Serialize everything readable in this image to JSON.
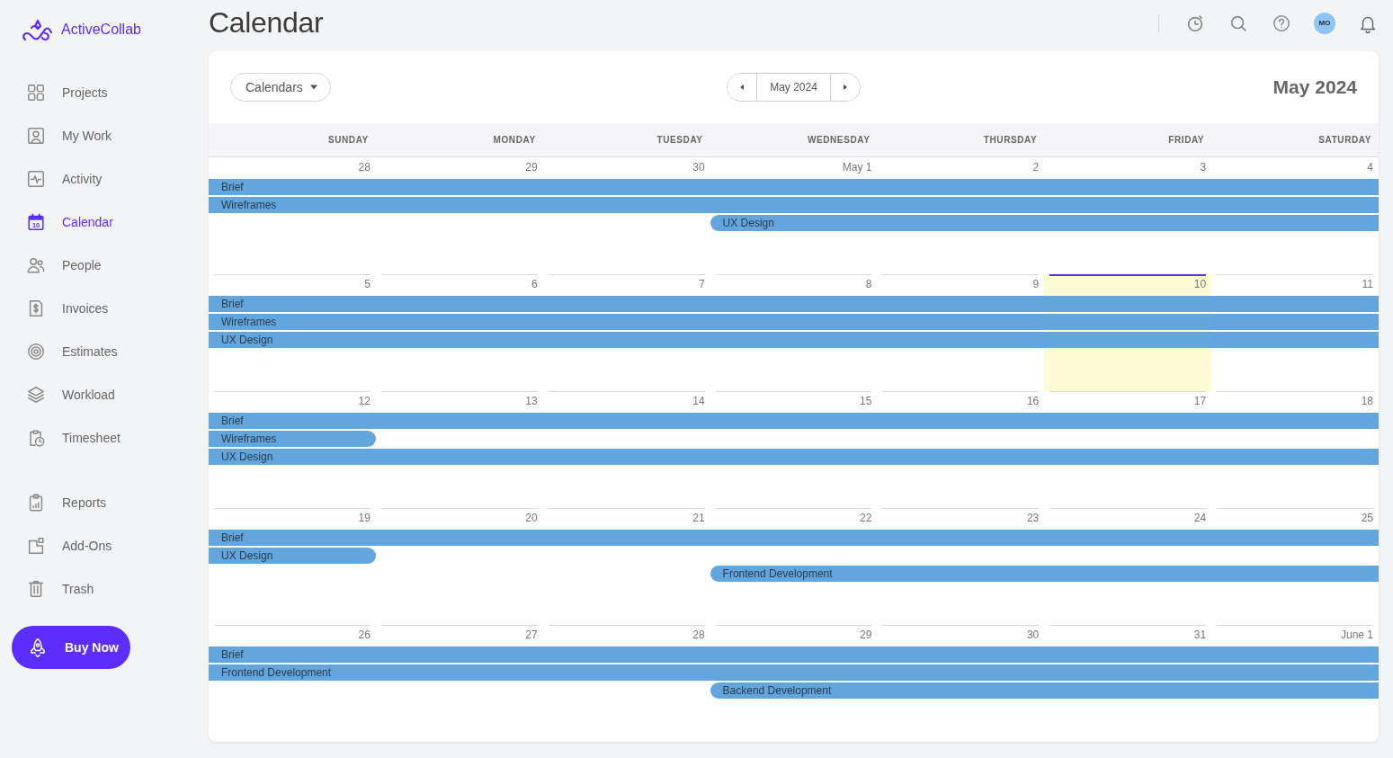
{
  "sidebar": {
    "logo": "ActiveCollab",
    "nav_groups": [
      [
        {
          "label": "Projects",
          "kind": "grid",
          "selected": false
        },
        {
          "label": "My Work",
          "kind": "user",
          "selected": false
        },
        {
          "label": "Activity",
          "kind": "activity",
          "selected": false
        },
        {
          "label": "Calendar",
          "kind": "calendar",
          "icon_text": "10",
          "selected": true
        },
        {
          "label": "People",
          "kind": "people",
          "selected": false
        },
        {
          "label": "Invoices",
          "kind": "invoice",
          "selected": false
        },
        {
          "label": "Estimates",
          "kind": "target",
          "selected": false
        },
        {
          "label": "Workload",
          "kind": "layers",
          "selected": false
        },
        {
          "label": "Timesheet",
          "kind": "timesheet",
          "selected": false
        }
      ],
      [
        {
          "label": "Reports",
          "kind": "reports",
          "selected": false
        },
        {
          "label": "Add-Ons",
          "kind": "addons",
          "selected": false
        },
        {
          "label": "Trash",
          "kind": "trash",
          "selected": false
        }
      ]
    ],
    "buy_button": "Buy Now"
  },
  "header": {
    "title": "Calendar",
    "avatar": "MO"
  },
  "toolbar": {
    "calendars_button": "Calendars",
    "period": "May 2024",
    "title": "May 2024"
  },
  "weekdays": [
    "SUNDAY",
    "MONDAY",
    "TUESDAY",
    "WEDNESDAY",
    "THURSDAY",
    "FRIDAY",
    "SATURDAY"
  ],
  "weeks": [
    {
      "days": [
        {
          "date": "28",
          "today": false,
          "events": [
            {
              "title": "Brief",
              "kind": "week",
              "starts": false,
              "ends": false
            },
            {
              "title": "Wireframes",
              "kind": "week",
              "starts": false,
              "ends": false
            }
          ]
        },
        {
          "date": "29",
          "today": false
        },
        {
          "date": "30",
          "today": false
        },
        {
          "date": "May 1",
          "today": false,
          "events": [
            {
              "title": "UX Design",
              "kind": "week",
              "starts": true,
              "ends": false
            }
          ]
        },
        {
          "date": "2",
          "today": false
        },
        {
          "date": "3",
          "today": false
        },
        {
          "date": "4",
          "today": false
        }
      ]
    },
    {
      "days": [
        {
          "date": "5",
          "today": false,
          "events": [
            {
              "title": "Brief",
              "kind": "week",
              "starts": false,
              "ends": false
            },
            {
              "title": "Wireframes",
              "kind": "week",
              "starts": false,
              "ends": false
            },
            {
              "title": "UX Design",
              "kind": "week",
              "starts": false,
              "ends": false
            }
          ]
        },
        {
          "date": "6",
          "today": false
        },
        {
          "date": "7",
          "today": false
        },
        {
          "date": "8",
          "today": false
        },
        {
          "date": "9",
          "today": false
        },
        {
          "date": "10",
          "today": true
        },
        {
          "date": "11",
          "today": false
        }
      ]
    },
    {
      "days": [
        {
          "date": "12",
          "today": false,
          "events": [
            {
              "title": "Brief",
              "kind": "week",
              "starts": false,
              "ends": false
            },
            {
              "title": "Wireframes",
              "kind": "day",
              "starts": false,
              "ends": true
            },
            {
              "title": "UX Design",
              "kind": "week",
              "starts": false,
              "ends": false
            }
          ]
        },
        {
          "date": "13",
          "today": false
        },
        {
          "date": "14",
          "today": false
        },
        {
          "date": "15",
          "today": false
        },
        {
          "date": "16",
          "today": false
        },
        {
          "date": "17",
          "today": false
        },
        {
          "date": "18",
          "today": false
        }
      ]
    },
    {
      "days": [
        {
          "date": "19",
          "today": false,
          "events": [
            {
              "title": "Brief",
              "kind": "week",
              "starts": false,
              "ends": false
            },
            {
              "title": "UX Design",
              "kind": "day",
              "starts": false,
              "ends": true
            }
          ]
        },
        {
          "date": "20",
          "today": false
        },
        {
          "date": "21",
          "today": false
        },
        {
          "date": "22",
          "today": false,
          "events": [
            {
              "title": "Frontend Development",
              "kind": "week",
              "starts": true,
              "ends": false
            }
          ]
        },
        {
          "date": "23",
          "today": false
        },
        {
          "date": "24",
          "today": false
        },
        {
          "date": "25",
          "today": false
        }
      ]
    },
    {
      "days": [
        {
          "date": "26",
          "today": false,
          "events": [
            {
              "title": "Brief",
              "kind": "week",
              "starts": false,
              "ends": false
            },
            {
              "title": "Frontend Development",
              "kind": "week",
              "starts": false,
              "ends": false
            }
          ]
        },
        {
          "date": "27",
          "today": false
        },
        {
          "date": "28",
          "today": false
        },
        {
          "date": "29",
          "today": false,
          "events": [
            {
              "title": "Backend Development",
              "kind": "week",
              "starts": true,
              "ends": false
            }
          ]
        },
        {
          "date": "30",
          "today": false
        },
        {
          "date": "31",
          "today": false
        },
        {
          "date": "June 1",
          "today": false
        }
      ]
    }
  ]
}
